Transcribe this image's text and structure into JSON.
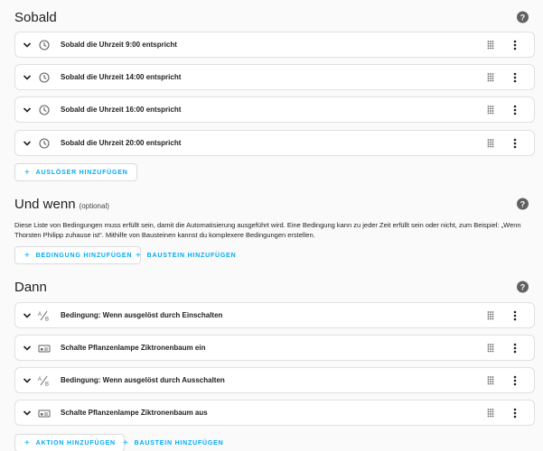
{
  "sobald": {
    "title": "Sobald",
    "triggers": [
      {
        "label": "Sobald die Uhrzeit 9:00 entspricht",
        "icon": "clock-icon"
      },
      {
        "label": "Sobald die Uhrzeit 14:00 entspricht",
        "icon": "clock-icon"
      },
      {
        "label": "Sobald die Uhrzeit 16:00 entspricht",
        "icon": "clock-icon"
      },
      {
        "label": "Sobald die Uhrzeit 20:00 entspricht",
        "icon": "clock-icon"
      }
    ],
    "add_trigger": "AUSLÖSER HINZUFÜGEN"
  },
  "und_wenn": {
    "title": "Und wenn",
    "optional": "(optional)",
    "description": "Diese Liste von Bedingungen muss erfüllt sein, damit die Automatisierung ausgeführt wird. Eine Bedingung kann zu jeder Zeit erfüllt sein oder nicht, zum Beispiel: „Wenn Thorsten Philipp zuhause ist“. Mithilfe von Bausteinen kannst du komplexere Bedingungen erstellen.",
    "add_condition": "BEDINGUNG HINZUFÜGEN",
    "add_block": "BAUSTEIN HINZUFÜGEN"
  },
  "dann": {
    "title": "Dann",
    "actions": [
      {
        "label": "Bedingung: Wenn ausgelöst durch Einschalten",
        "icon": "condition-icon"
      },
      {
        "label": "Schalte Pflanzenlampe Ziktronenbaum ein",
        "icon": "device-icon"
      },
      {
        "label": "Bedingung: Wenn ausgelöst durch Ausschalten",
        "icon": "condition-icon"
      },
      {
        "label": "Schalte Pflanzenlampe Ziktronenbaum aus",
        "icon": "device-icon"
      }
    ],
    "add_action": "AKTION HINZUFÜGEN",
    "add_block": "BAUSTEIN HINZUFÜGEN"
  },
  "help_glyph": "?",
  "plus_glyph": "+",
  "colors": {
    "background": "#fafafa",
    "card": "#ffffff",
    "accent": "#03a9f4",
    "icon": "#616161"
  }
}
